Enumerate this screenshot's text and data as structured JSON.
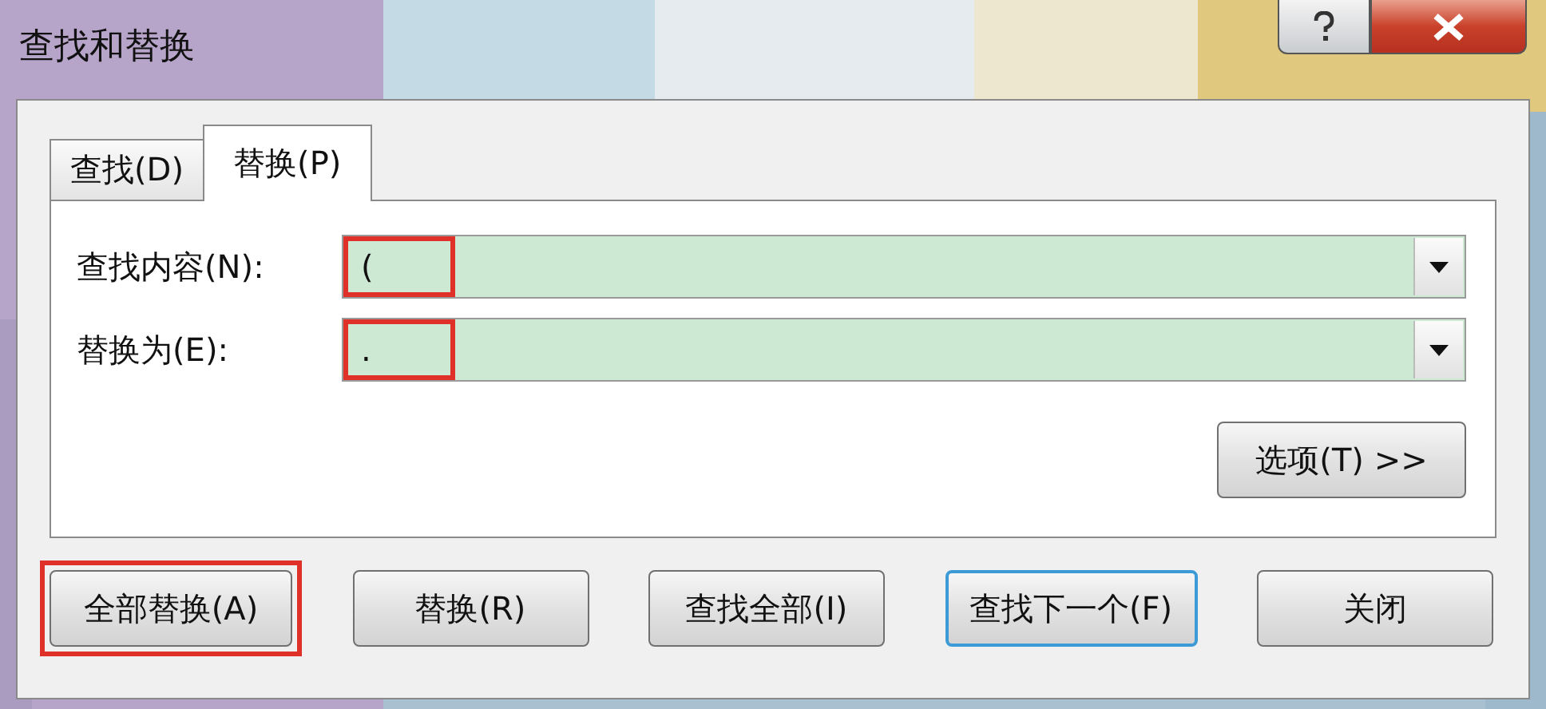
{
  "window": {
    "title": "查找和替换"
  },
  "tabs": [
    {
      "label": "查找(D)",
      "selected": false
    },
    {
      "label": "替换(P)",
      "selected": true
    }
  ],
  "fields": [
    {
      "label": "查找内容(N):",
      "value": "(",
      "highlighted": true
    },
    {
      "label": "替换为(E):",
      "value": ".",
      "highlighted": true
    }
  ],
  "options_button": {
    "label": "选项(T) >>"
  },
  "buttons": [
    {
      "label": "全部替换(A)",
      "highlighted": true,
      "default": false
    },
    {
      "label": "替换(R)",
      "highlighted": false,
      "default": false
    },
    {
      "label": "查找全部(I)",
      "highlighted": false,
      "default": false
    },
    {
      "label": "查找下一个(F)",
      "highlighted": false,
      "default": true
    },
    {
      "label": "关闭",
      "highlighted": false,
      "default": false
    }
  ]
}
